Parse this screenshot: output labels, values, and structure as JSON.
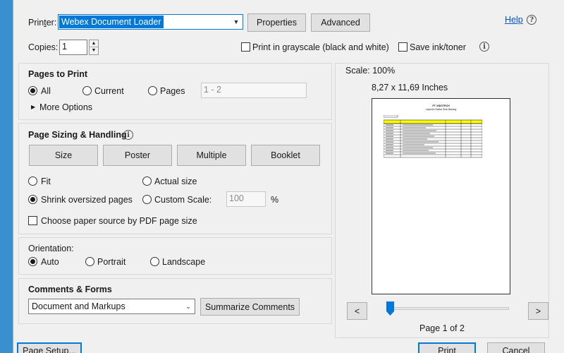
{
  "printer": {
    "label": "Printer:",
    "value": "Webex Document Loader",
    "properties": "Properties",
    "advanced": "Advanced"
  },
  "help": "Help",
  "copies": {
    "label": "Copies:",
    "value": "1"
  },
  "grayscale_label": "Print in grayscale (black and white)",
  "save_ink_label": "Save ink/toner",
  "pages": {
    "title": "Pages to Print",
    "all": "All",
    "current": "Current",
    "pages": "Pages",
    "range_placeholder": "1 - 2",
    "more_options": "More Options"
  },
  "sizing": {
    "title": "Page Sizing & Handling",
    "buttons": [
      "Size",
      "Poster",
      "Multiple",
      "Booklet"
    ],
    "fit": "Fit",
    "actual": "Actual size",
    "shrink": "Shrink oversized pages",
    "custom": "Custom Scale:",
    "custom_value": "100",
    "percent": "%",
    "paper_source": "Choose paper source by PDF page size"
  },
  "orientation": {
    "title": "Orientation:",
    "auto": "Auto",
    "portrait": "Portrait",
    "landscape": "Landscape"
  },
  "comments": {
    "title": "Comments & Forms",
    "value": "Document and Markups",
    "summarize": "Summarize Comments"
  },
  "preview": {
    "scale": "Scale: 100%",
    "size": "8,27 x 11,69 Inches",
    "doc_title": "PT. INDOTECH",
    "doc_subtitle": "Laporan Daftar Stok Barang",
    "prev": "<",
    "next": ">",
    "page_info": "Page 1 of 2",
    "slider_fraction": 0
  },
  "footer": {
    "page_setup": "Page Setup...",
    "print": "Print",
    "cancel": "Cancel"
  }
}
